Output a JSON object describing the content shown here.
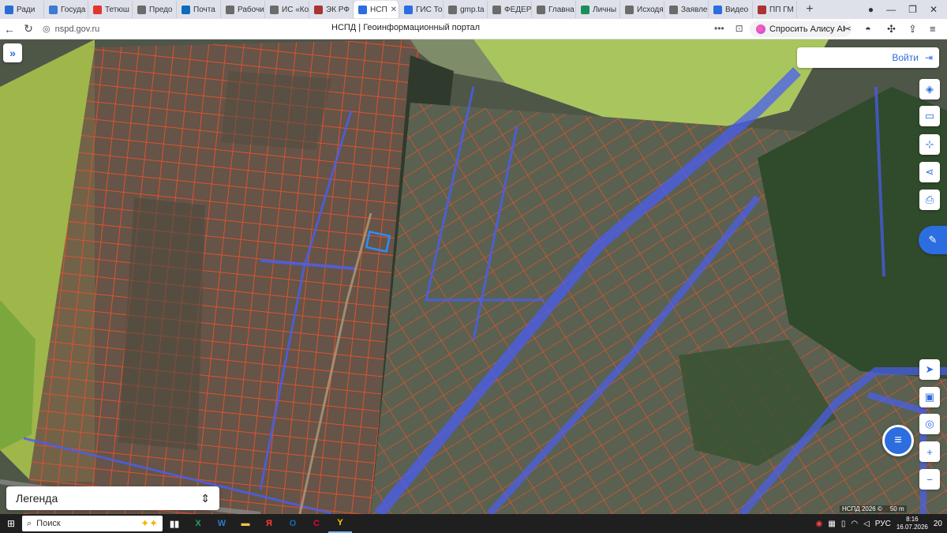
{
  "browser": {
    "tabs": [
      {
        "label": "Ради",
        "icon": "radio-icon",
        "color": "#2b6cd4"
      },
      {
        "label": "Госуда",
        "icon": "gov-icon",
        "color": "#3a7bd5"
      },
      {
        "label": "Тетюш",
        "icon": "map-pin-icon",
        "color": "#e3342f"
      },
      {
        "label": "Предо",
        "icon": "globe-icon",
        "color": "#6b6b6b"
      },
      {
        "label": "Почта",
        "icon": "outlook-icon",
        "color": "#0f6cbd"
      },
      {
        "label": "Рабочи",
        "icon": "document-icon",
        "color": "#6b6b6b"
      },
      {
        "label": "ИС «Ко",
        "icon": "pen-icon",
        "color": "#6b6b6b"
      },
      {
        "label": "ЭК РФ",
        "icon": "emblem-icon",
        "color": "#a33"
      },
      {
        "label": "НСП",
        "icon": "nspd-icon",
        "color": "#2c6de0"
      },
      {
        "label": "ГИС То",
        "icon": "gis-icon",
        "color": "#2c6de0"
      },
      {
        "label": "gmp.ta",
        "icon": "document-icon",
        "color": "#6b6b6b"
      },
      {
        "label": "ФЕДЕР",
        "icon": "globe-icon",
        "color": "#6b6b6b"
      },
      {
        "label": "Главна",
        "icon": "document-icon",
        "color": "#6b6b6b"
      },
      {
        "label": "Личны",
        "icon": "check-icon",
        "color": "#1a8f5a"
      },
      {
        "label": "Исходя",
        "icon": "document-icon",
        "color": "#6b6b6b"
      },
      {
        "label": "Заявле",
        "icon": "document-icon",
        "color": "#6b6b6b"
      },
      {
        "label": "Видео",
        "icon": "video-icon",
        "color": "#2c6de0"
      },
      {
        "label": "ПП ГМ",
        "icon": "emblem-icon",
        "color": "#a33"
      }
    ],
    "active_tab_index": 8,
    "url": "nspd.gov.ru",
    "page_title": "НСПД | Геоинформационный портал",
    "alisa_label": "Спросить Алису AI"
  },
  "map": {
    "login_label": "Войти",
    "legend_label": "Легенда",
    "attribution": "НСПД 2026 ©",
    "scale_label": "50 m"
  },
  "taskbar": {
    "search_placeholder": "Поиск",
    "language": "РУС",
    "time": "8:16",
    "date": "16.07.2026",
    "notifications_count": "20"
  },
  "colors": {
    "accent": "#2c6de0",
    "parcel_border": "#e0502e",
    "zone_blue": "#4a5ef0",
    "field_green": "#9fb64b"
  }
}
